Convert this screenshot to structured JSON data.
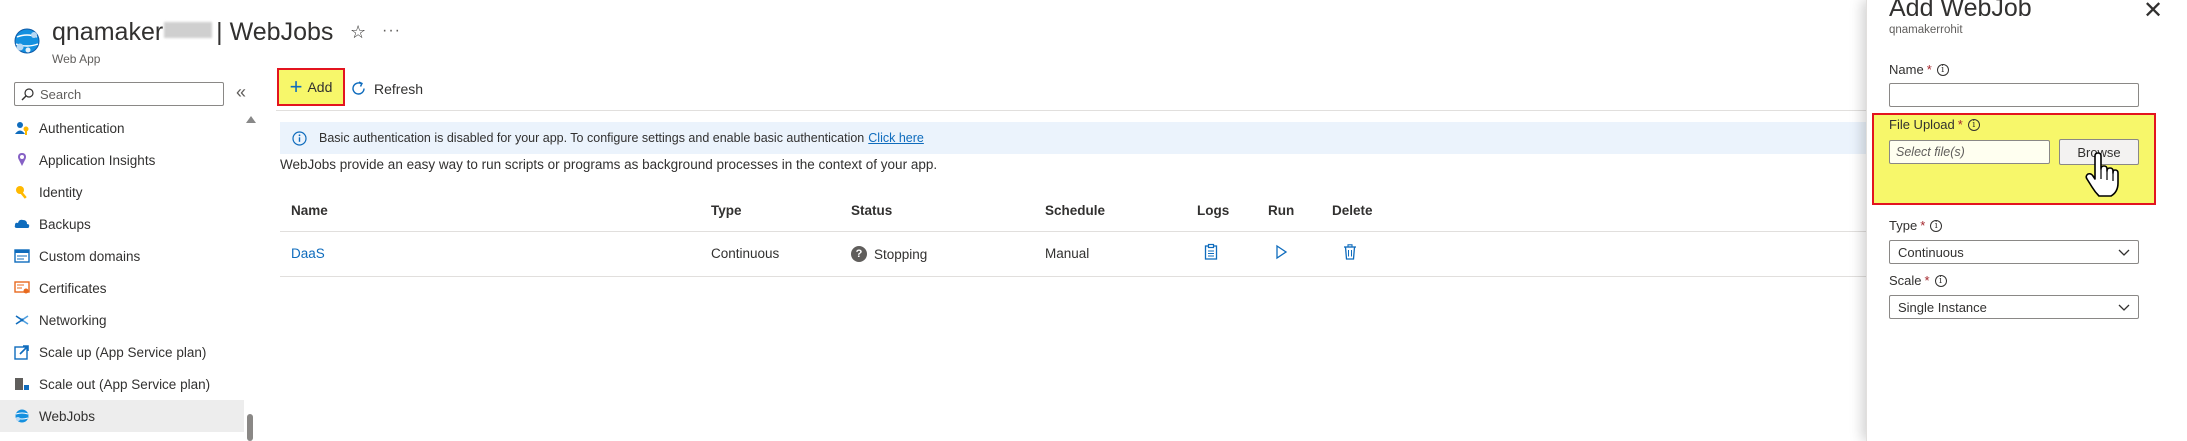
{
  "header": {
    "title_prefix": "qnamaker",
    "title_suffix": "| WebJobs",
    "subtitle": "Web App",
    "star_glyph": "☆",
    "more_glyph": "···"
  },
  "sidebar": {
    "search_placeholder": "Search",
    "collapse_glyph": "«",
    "items": [
      {
        "label": "Authentication",
        "icon": "authentication-icon"
      },
      {
        "label": "Application Insights",
        "icon": "application-insights-icon"
      },
      {
        "label": "Identity",
        "icon": "identity-icon"
      },
      {
        "label": "Backups",
        "icon": "backups-icon"
      },
      {
        "label": "Custom domains",
        "icon": "custom-domains-icon"
      },
      {
        "label": "Certificates",
        "icon": "certificates-icon"
      },
      {
        "label": "Networking",
        "icon": "networking-icon"
      },
      {
        "label": "Scale up (App Service plan)",
        "icon": "scale-up-icon"
      },
      {
        "label": "Scale out (App Service plan)",
        "icon": "scale-out-icon"
      },
      {
        "label": "WebJobs",
        "icon": "webjobs-icon",
        "active": true
      }
    ]
  },
  "toolbar": {
    "add_label": "Add",
    "refresh_label": "Refresh"
  },
  "banner": {
    "text": "Basic authentication is disabled for your app. To configure settings and enable basic authentication",
    "link": "Click here"
  },
  "description": "WebJobs provide an easy way to run scripts or programs as background processes in the context of your app.",
  "table": {
    "columns": [
      "Name",
      "Type",
      "Status",
      "Schedule",
      "Logs",
      "Run",
      "Delete"
    ],
    "rows": [
      {
        "name": "DaaS",
        "type": "Continuous",
        "status": "Stopping",
        "schedule": "Manual"
      }
    ]
  },
  "panel": {
    "title": "Add WebJob",
    "subtitle": "qnamakerrohit",
    "close_glyph": "✕",
    "name_label": "Name",
    "file_upload_label": "File Upload",
    "file_placeholder": "Select file(s)",
    "browse_label": "Browse",
    "type_label": "Type",
    "type_value": "Continuous",
    "scale_label": "Scale",
    "scale_value": "Single Instance",
    "required_marker": "*",
    "info_glyph": "i"
  },
  "colors": {
    "accent": "#0f6cbd",
    "highlight": "#f7f76a",
    "highlight_border": "#e3141f",
    "banner_bg": "#ebf3fc"
  }
}
